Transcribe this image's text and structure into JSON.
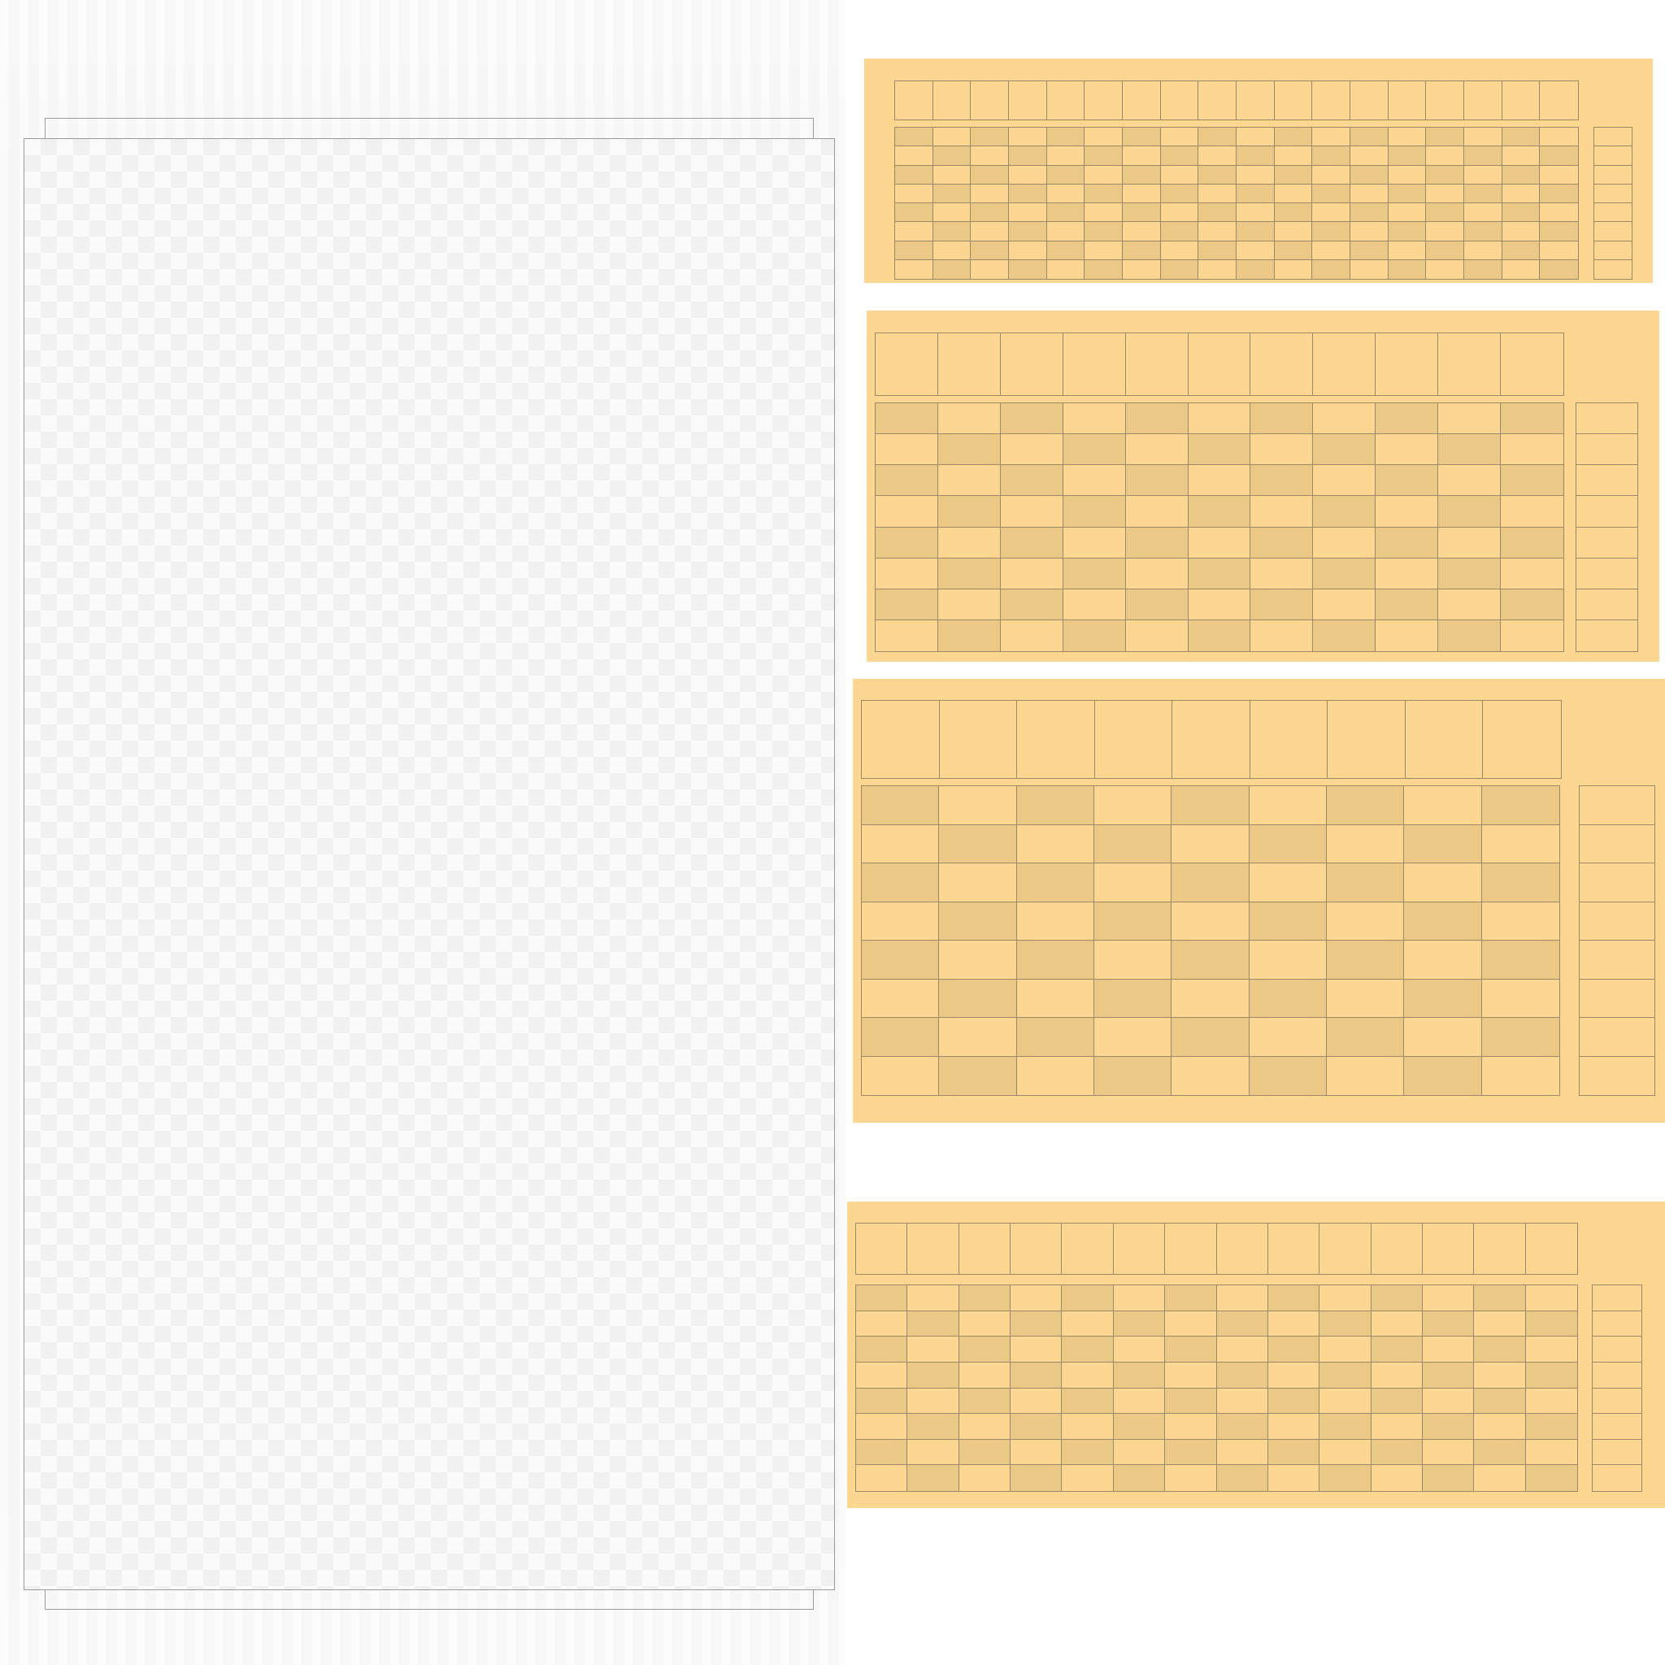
{
  "page": {
    "background": "#ffffff"
  },
  "left_panel": {
    "background": "#f6f6f6",
    "sheet_outline_color": "#9a9a9a",
    "checker_color": "#f1f1f1"
  },
  "cards": {
    "fill": "#fdd792",
    "alt_cell_fill": "#ecc886",
    "line_color": "#9a8a6a",
    "items": [
      {
        "name": "card-1",
        "header_columns": 18,
        "grid_columns": 18,
        "grid_rows": 8,
        "side_rows": 8
      },
      {
        "name": "card-2",
        "header_columns": 11,
        "grid_columns": 11,
        "grid_rows": 8,
        "side_rows": 8
      },
      {
        "name": "card-3",
        "header_columns": 9,
        "grid_columns": 9,
        "grid_rows": 8,
        "side_rows": 8
      },
      {
        "name": "card-4",
        "header_columns": 14,
        "grid_columns": 14,
        "grid_rows": 8,
        "side_rows": 8
      }
    ]
  }
}
